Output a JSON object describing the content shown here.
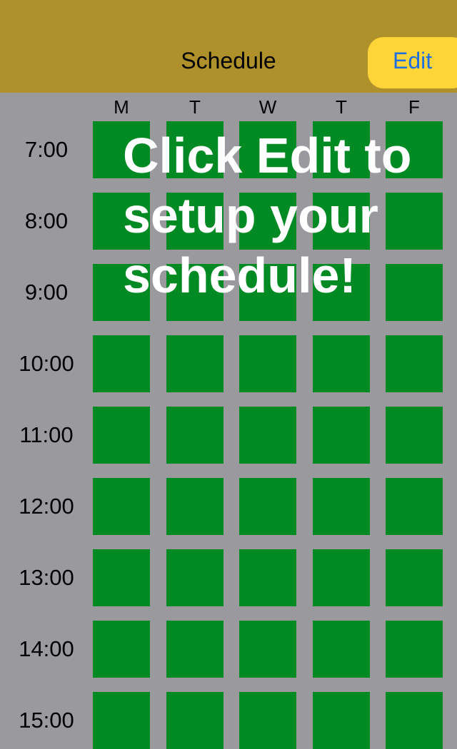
{
  "navbar": {
    "title": "Schedule",
    "edit_label": "Edit"
  },
  "days": [
    "M",
    "T",
    "W",
    "T",
    "F"
  ],
  "times": [
    "7:00",
    "8:00",
    "9:00",
    "10:00",
    "11:00",
    "12:00",
    "13:00",
    "14:00",
    "15:00"
  ],
  "overlay": {
    "message": "Click Edit to setup your schedule!"
  },
  "colors": {
    "navbar": "#ae912a",
    "edit_button": "#fed538",
    "edit_text": "#1f6fe0",
    "slot": "#008a23",
    "background": "#9a999e"
  }
}
